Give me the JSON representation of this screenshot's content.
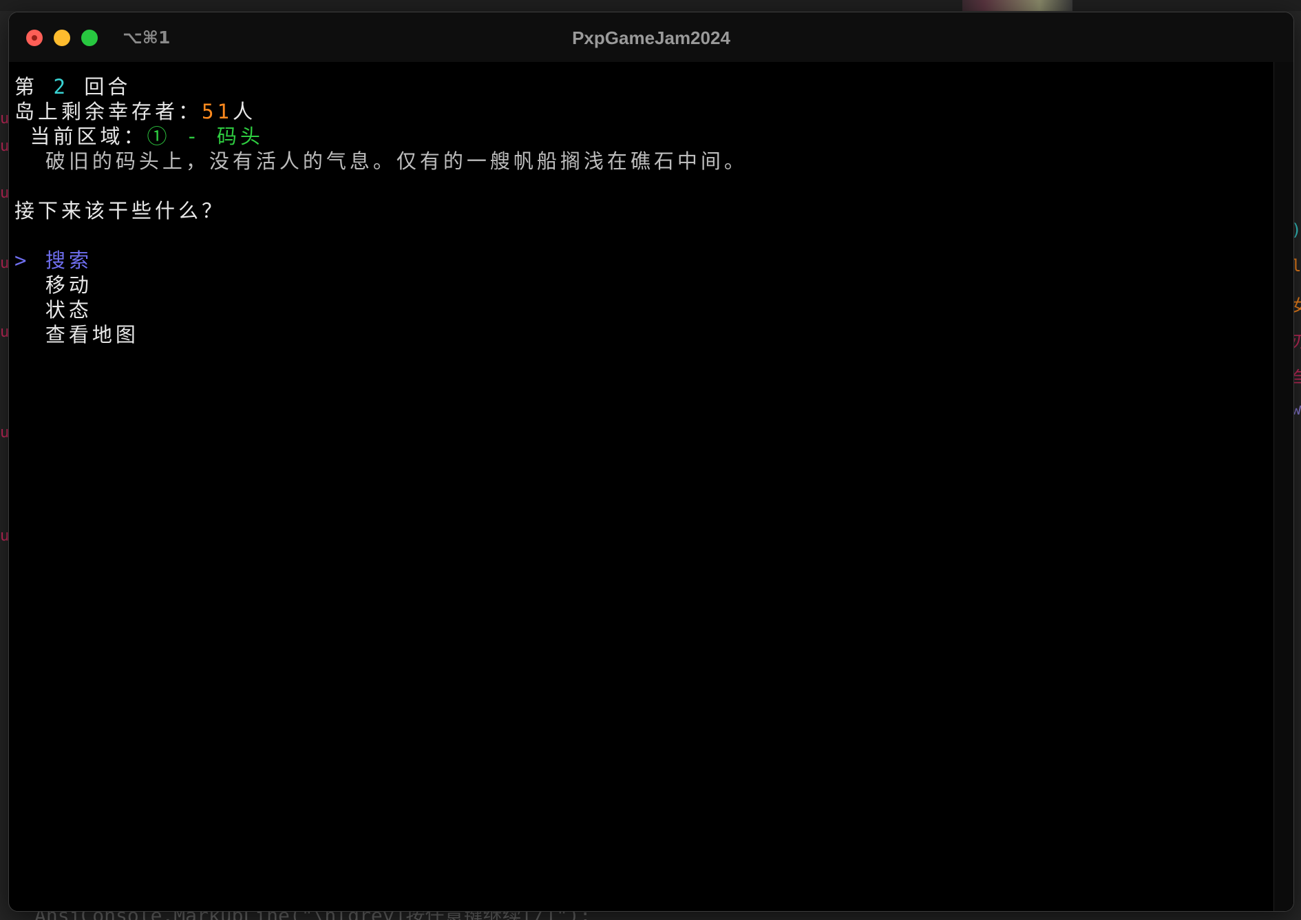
{
  "window": {
    "shortcut": "⌥⌘1",
    "title": "PxpGameJam2024"
  },
  "terminal": {
    "round": {
      "prefix": "第",
      "number": "2",
      "suffix": "回合"
    },
    "survivors": {
      "label": "岛上剩余幸存者：",
      "count": "51",
      "unit": "人"
    },
    "area": {
      "label": "当前区域：",
      "value": "① - 码头"
    },
    "description": "破旧的码头上，没有活人的气息。仅有的一艘帆船搁浅在礁石中间。",
    "prompt": "接下来该干些什么？",
    "menu": {
      "cursor": ">",
      "items": [
        {
          "label": "搜索",
          "selected": true
        },
        {
          "label": "移动",
          "selected": false
        },
        {
          "label": "状态",
          "selected": false
        },
        {
          "label": "查看地图",
          "selected": false
        }
      ]
    }
  },
  "colors": {
    "round_number": "#39d3d3",
    "survivor_count": "#ff8a1e",
    "area_value": "#2ecc40",
    "selected_item": "#6f6ff0",
    "description": "#bdbdbd"
  }
}
